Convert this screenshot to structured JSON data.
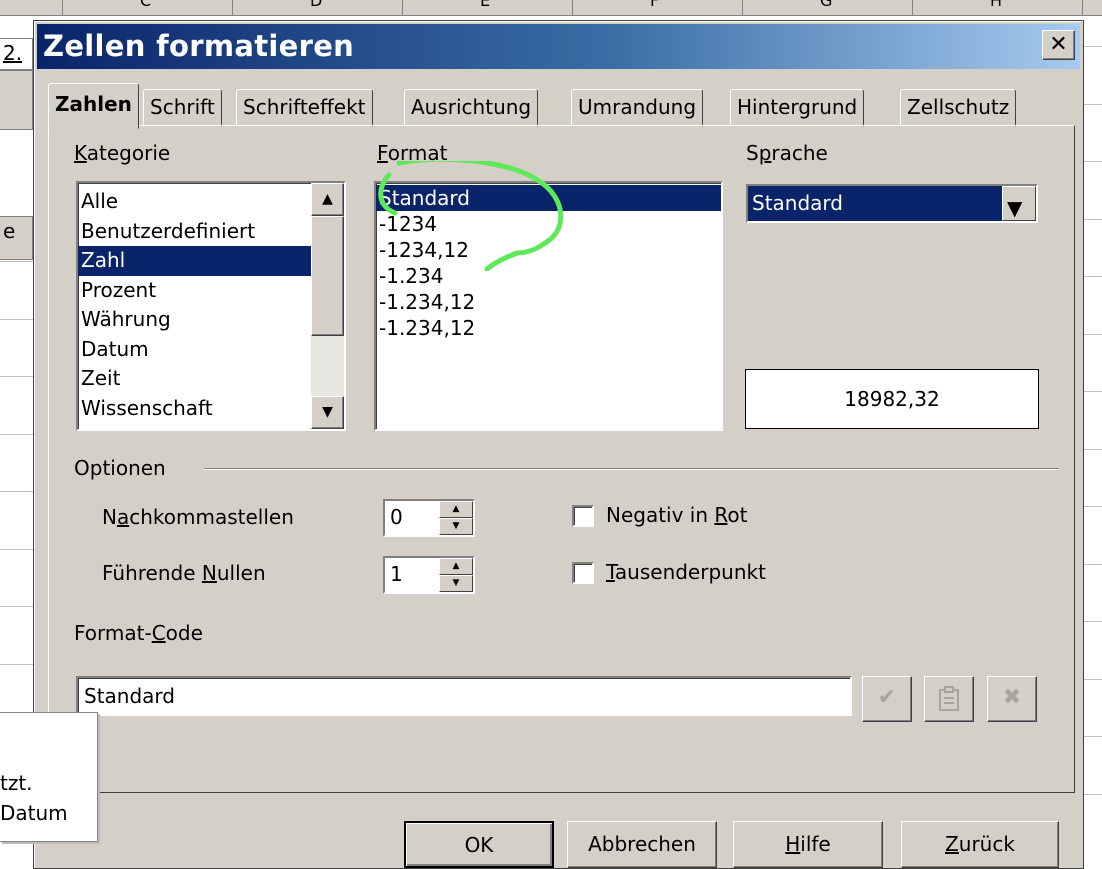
{
  "background": {
    "column_letters": [
      "C",
      "D",
      "E",
      "F",
      "G",
      "H"
    ],
    "left_tabs": [
      "2.",
      "e"
    ],
    "tooltip_lines": [
      "tzt.",
      "Datum"
    ]
  },
  "dialog": {
    "title": "Zellen formatieren",
    "close_glyph": "✕",
    "tabs": [
      "Zahlen",
      "Schrift",
      "Schrifteffekt",
      "Ausrichtung",
      "Umrandung",
      "Hintergrund",
      "Zellschutz"
    ],
    "active_tab": "Zahlen",
    "kategorie": {
      "label_pre": "",
      "label_key": "K",
      "label_post": "ategorie",
      "items": [
        "Alle",
        "Benutzerdefiniert",
        "Zahl",
        "Prozent",
        "Währung",
        "Datum",
        "Zeit",
        "Wissenschaft"
      ],
      "selected": "Zahl"
    },
    "format": {
      "label_pre": "",
      "label_key": "F",
      "label_post": "ormat",
      "items": [
        "Standard",
        "-1234",
        "-1234,12",
        "-1.234",
        "-1.234,12",
        "-1.234,12"
      ],
      "selected": "Standard"
    },
    "sprache": {
      "label_pre": "S",
      "label_key": "p",
      "label_post": "rache",
      "value": "Standard"
    },
    "preview": "18982,32",
    "optionen": {
      "label": "Optionen",
      "nachkommastellen": {
        "label_pre": "N",
        "label_key": "a",
        "label_post": "chkommastellen",
        "value": "0"
      },
      "fuehrende_nullen": {
        "label_pre": "Führende ",
        "label_key": "N",
        "label_post": "ullen",
        "value": "1"
      },
      "negativ_rot": {
        "label_pre": "Negativ in ",
        "label_key": "R",
        "label_post": "ot",
        "checked": false
      },
      "tausenderpunkt": {
        "label_pre": "",
        "label_key": "T",
        "label_post": "ausenderpunkt",
        "checked": false
      }
    },
    "format_code": {
      "label_pre": "Format-",
      "label_key": "C",
      "label_post": "ode",
      "value": "Standard"
    },
    "buttons": {
      "ok": "OK",
      "abbrechen": "Abbrechen",
      "hilfe_key": "H",
      "hilfe_post": "ilfe",
      "zurueck_key": "Z",
      "zurueck_post": "urück"
    },
    "colors": {
      "selection": "#0a246a",
      "dialog_face": "#d4d0c8",
      "annotation": "#5ee85a"
    }
  }
}
